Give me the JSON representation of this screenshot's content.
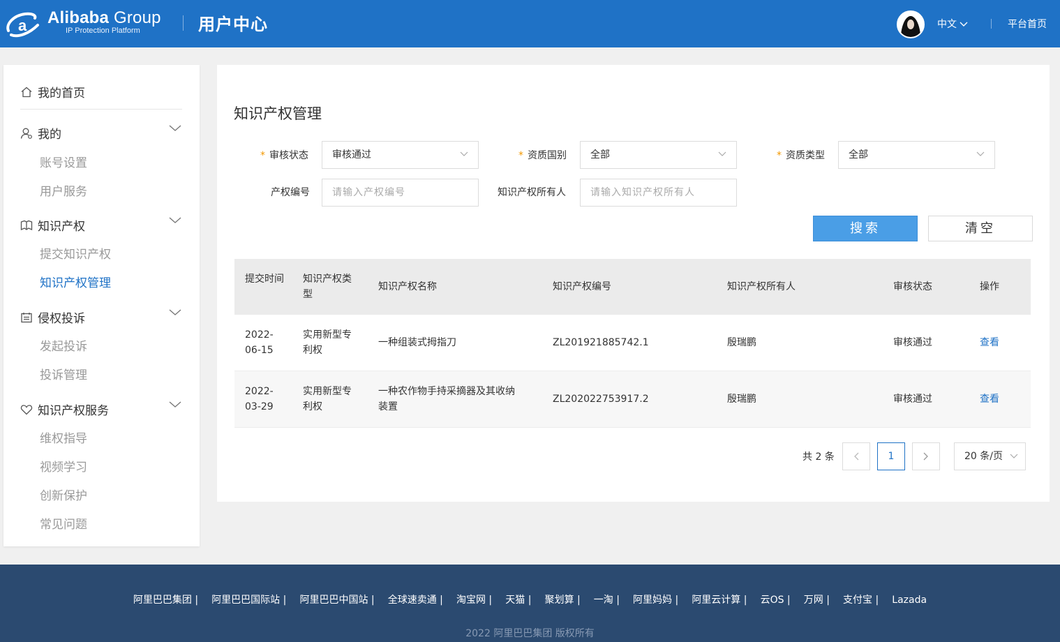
{
  "header": {
    "logo_brand": "Alibaba",
    "logo_group": "Group",
    "logo_sub": "IP Protection Platform",
    "title": "用户中心",
    "language": "中文",
    "platform_home": "平台首页"
  },
  "sidebar": {
    "home": "我的首页",
    "sections": [
      {
        "label": "我的",
        "icon": "user-icon",
        "children": [
          "账号设置",
          "用户服务"
        ]
      },
      {
        "label": "知识产权",
        "icon": "book-icon",
        "children": [
          "提交知识产权",
          "知识产权管理"
        ]
      },
      {
        "label": "侵权投诉",
        "icon": "document-icon",
        "children": [
          "发起投诉",
          "投诉管理"
        ]
      },
      {
        "label": "知识产权服务",
        "icon": "heart-icon",
        "children": [
          "维权指导",
          "视频学习",
          "创新保护",
          "常见问题"
        ]
      }
    ],
    "active_item": "知识产权管理"
  },
  "main": {
    "title": "知识产权管理",
    "filters": {
      "review_status": {
        "label": "审核状态",
        "value": "审核通过"
      },
      "country": {
        "label": "资质国别",
        "value": "全部"
      },
      "qual_type": {
        "label": "资质类型",
        "value": "全部"
      },
      "ip_number": {
        "label": "产权编号",
        "placeholder": "请输入产权编号"
      },
      "ip_owner": {
        "label": "知识产权所有人",
        "placeholder": "请输入知识产权所有人"
      }
    },
    "search_label": "搜索",
    "clear_label": "清空",
    "table": {
      "headers": [
        "提交时间",
        "知识产权类型",
        "知识产权名称",
        "知识产权编号",
        "知识产权所有人",
        "审核状态",
        "操作"
      ],
      "rows": [
        {
          "date_a": "2022-",
          "date_b": "06-15",
          "type_a": "实用新型专",
          "type_b": "利权",
          "name_a": "一种组装式拇指刀",
          "name_b": "",
          "number": "ZL201921885742.1",
          "owner": "殷瑞鹏",
          "status": "审核通过",
          "action": "查看"
        },
        {
          "date_a": "2022-",
          "date_b": "03-29",
          "type_a": "实用新型专",
          "type_b": "利权",
          "name_a": "一种农作物手持采摘器及其收纳",
          "name_b": "装置",
          "number": "ZL202022753917.2",
          "owner": "殷瑞鹏",
          "status": "审核通过",
          "action": "查看"
        }
      ]
    },
    "pagination": {
      "total_text": "共 2 条",
      "current_page": "1",
      "page_size": "20 条/页"
    }
  },
  "footer": {
    "links": [
      "阿里巴巴集团 |",
      "阿里巴巴国际站 |",
      "阿里巴巴中国站 |",
      "全球速卖通 |",
      "淘宝网 |",
      "天猫 |",
      "聚划算 |",
      "一淘 |",
      "阿里妈妈 |",
      "阿里云计算 |",
      "云OS |",
      "万网 |",
      "支付宝 |",
      "Lazada"
    ],
    "copyright": "2022 阿里巴巴集团 版权所有"
  },
  "colors": {
    "header_bg": "#1f72c6",
    "accent": "#1f72c6",
    "search_button": "#4a9ee6",
    "required_mark": "#f39800",
    "footer_bg": "#2b4a70"
  }
}
